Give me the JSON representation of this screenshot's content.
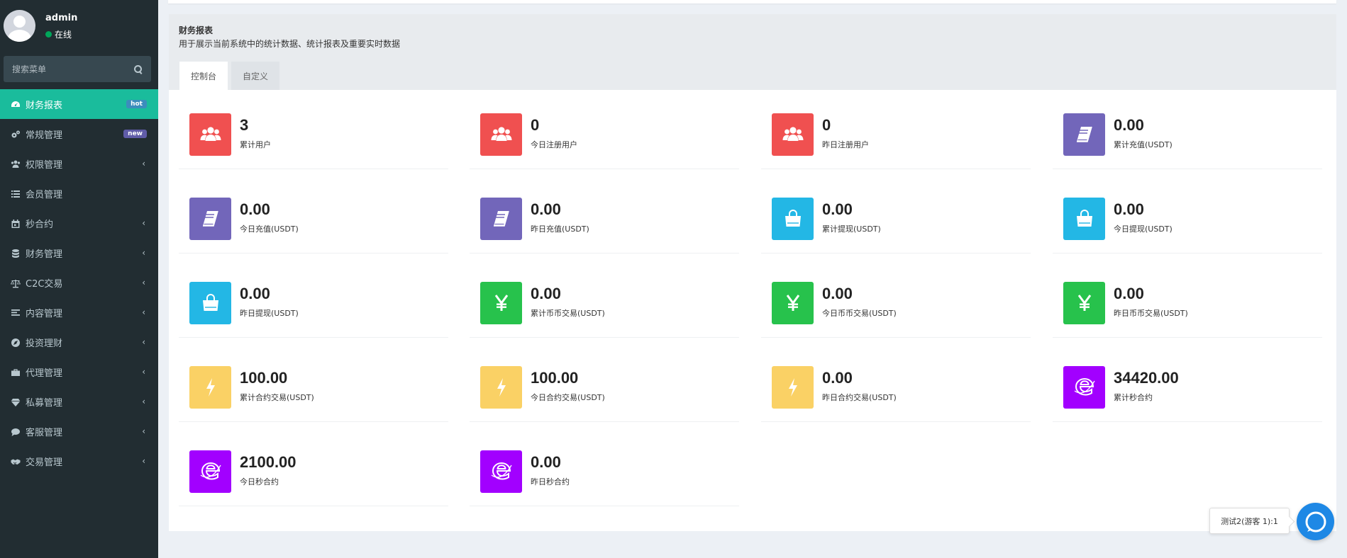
{
  "user": {
    "name": "admin",
    "status": "在线"
  },
  "search": {
    "placeholder": "搜索菜单"
  },
  "menu": [
    {
      "label": "财务报表",
      "icon": "dashboard-icon",
      "badge": "hot",
      "active": true
    },
    {
      "label": "常规管理",
      "icon": "cogs-icon",
      "badge": "new"
    },
    {
      "label": "权限管理",
      "icon": "group-icon",
      "chevron": "‹"
    },
    {
      "label": "会员管理",
      "icon": "list-icon"
    },
    {
      "label": "秒合约",
      "icon": "calendar-icon",
      "chevron": "‹"
    },
    {
      "label": "财务管理",
      "icon": "database-icon",
      "chevron": "‹"
    },
    {
      "label": "C2C交易",
      "icon": "balance-scale-icon",
      "chevron": "‹"
    },
    {
      "label": "内容管理",
      "icon": "align-left-icon",
      "chevron": "‹"
    },
    {
      "label": "投资理财",
      "icon": "compass-icon",
      "chevron": "‹"
    },
    {
      "label": "代理管理",
      "icon": "briefcase-icon",
      "chevron": "‹"
    },
    {
      "label": "私募管理",
      "icon": "diamond-icon",
      "chevron": "‹"
    },
    {
      "label": "客服管理",
      "icon": "comment-icon",
      "chevron": "‹"
    },
    {
      "label": "交易管理",
      "icon": "handshake-icon",
      "chevron": "‹"
    }
  ],
  "panel": {
    "title": "财务报表",
    "subtitle": "用于展示当前系统中的统计数据、统计报表及重要实时数据",
    "tabs": [
      {
        "label": "控制台",
        "active": true
      },
      {
        "label": "自定义"
      }
    ]
  },
  "colors": {
    "red": "#f05050",
    "purple": "#7266ba",
    "cyan": "#23b7e5",
    "green": "#27c24c",
    "yellow": "#fad165",
    "violet": "#a200ff"
  },
  "cards": [
    {
      "value": "3",
      "label": "累计用户",
      "icon": "users-icon",
      "color": "#f05050"
    },
    {
      "value": "0",
      "label": "今日注册用户",
      "icon": "users-icon",
      "color": "#f05050"
    },
    {
      "value": "0",
      "label": "昨日注册用户",
      "icon": "users-icon",
      "color": "#f05050"
    },
    {
      "value": "0.00",
      "label": "累计充值(USDT)",
      "icon": "book-icon",
      "color": "#7266ba"
    },
    {
      "value": "0.00",
      "label": "今日充值(USDT)",
      "icon": "book-icon",
      "color": "#7266ba"
    },
    {
      "value": "0.00",
      "label": "昨日充值(USDT)",
      "icon": "book-icon",
      "color": "#7266ba"
    },
    {
      "value": "0.00",
      "label": "累计提现(USDT)",
      "icon": "shopping-bag-icon",
      "color": "#23b7e5"
    },
    {
      "value": "0.00",
      "label": "今日提现(USDT)",
      "icon": "shopping-bag-icon",
      "color": "#23b7e5"
    },
    {
      "value": "0.00",
      "label": "昨日提现(USDT)",
      "icon": "shopping-bag-icon",
      "color": "#23b7e5"
    },
    {
      "value": "0.00",
      "label": "累计币币交易(USDT)",
      "icon": "yen-icon",
      "color": "#27c24c"
    },
    {
      "value": "0.00",
      "label": "今日币币交易(USDT)",
      "icon": "yen-icon",
      "color": "#27c24c"
    },
    {
      "value": "0.00",
      "label": "昨日币币交易(USDT)",
      "icon": "yen-icon",
      "color": "#27c24c"
    },
    {
      "value": "100.00",
      "label": "累计合约交易(USDT)",
      "icon": "bolt-icon",
      "color": "#fad165"
    },
    {
      "value": "100.00",
      "label": "今日合约交易(USDT)",
      "icon": "bolt-icon",
      "color": "#fad165"
    },
    {
      "value": "0.00",
      "label": "昨日合约交易(USDT)",
      "icon": "bolt-icon",
      "color": "#fad165"
    },
    {
      "value": "34420.00",
      "label": "累计秒合约",
      "icon": "edge-icon",
      "color": "#a200ff"
    },
    {
      "value": "2100.00",
      "label": "今日秒合约",
      "icon": "edge-icon",
      "color": "#a200ff"
    },
    {
      "value": "0.00",
      "label": "昨日秒合约",
      "icon": "edge-icon",
      "color": "#a200ff"
    }
  ],
  "chat": {
    "bubble_text": "测试2(游客 1):1"
  }
}
